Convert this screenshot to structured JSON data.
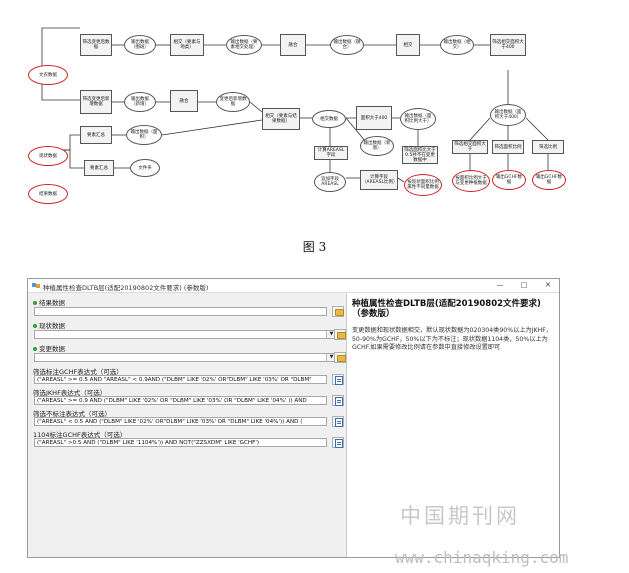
{
  "figure": {
    "caption": "图 3",
    "nodes": {
      "red1": "文农数据",
      "red2": "现状数据",
      "red3": "结果数据",
      "r1b1": "筛选变更后数据",
      "r1e1": "输出数据（图斑）",
      "r1b2": "相交（要素与地类）",
      "r1e2": "输出数据（要素相交处理）",
      "r1b3": "融合",
      "r1e3": "输出数据（融合）",
      "r1b4": "相交",
      "r1e4": "输出数据（相交）",
      "r1b5": "筛选相交面积大于400",
      "r2b1": "筛选变更后新增数据",
      "r2e1": "输出数据（新增）",
      "r2b2": "融合",
      "r2e2": "变更后新增数据",
      "mid1": "相交（要素与结果数据）",
      "mid2": "相交数据",
      "r3b1": "计算面积",
      "r3e1": "输出数据（新增）",
      "r3b2": "面积大于400",
      "r3e2": "输出数据（面积大于400）",
      "r3e3": "输出数据（面积）",
      "l1": "计算AREASL字段",
      "l2": "追加字段AREASL",
      "l3": "计算字段（AREASL比例）",
      "l4": "筛选面积比大于0.5并不在变更数据中",
      "red_s1": "按现状面积比例属性不同量数据",
      "right1": "输出数据（面积比例大于）",
      "ra": "筛选相交面积大于",
      "rb": "筛选面积比例",
      "rc": "筛选比例",
      "rd": "筛选比例",
      "red_r1": "按面积比例大于与变更种植数据",
      "red_r2": "输出GCHF数据",
      "red_r3": "输出GCHF数据",
      "sum1": "要素汇总",
      "sum2": "要素汇总",
      "sum3": "文件夹"
    }
  },
  "window": {
    "title": "种植属性检查DLTB层(适配20190802文件要求) (参数版)",
    "minimize": "—",
    "maximize": "□",
    "close": "✕",
    "params": {
      "p1_label": "结果数据",
      "p1_value": "",
      "p2_label": "现状数据",
      "p2_value": "",
      "p3_label": "变更数据",
      "p3_value": "",
      "p4_label": "筛选标注GCHF表达式（可选）",
      "p4_value": "(\"AREASL\" >= 0.5 AND \"AREASL\" < 0.9AND (\"DLBM\" LIKE '02%' OR\"DLBM\" LIKE '03%' OR \"DLBM\"",
      "p5_label": "筛选JKHF表达式（可选）",
      "p5_value": "(\"AREASL\" >= 0.9 AND (\"DLBM\" LIKE '02%' OR \"DLBM\" LIKE '03%' OR \"DLBM\" LIKE '04%' )) AND",
      "p6_label": "筛选不标注表达式（可选）",
      "p6_value": "(\"AREASL\" < 0.5  AND (\"DLBM\" LIKE '02%' OR\"DLBM\" LIKE '03%' OR \"DLBM\" LIKE '04%')) AND (",
      "p7_label": "1104标注GCHF表达式（可选）",
      "p7_value": "(\"AREASL\" >0.5 AND (\"DLBM\" LIKE '1104%')) AND NOT(\"ZZSXDM\" LIKE 'GCHF')"
    },
    "help": {
      "title": "种植属性检查DLTB层(适配20190802文件要求)（参数版）",
      "body": "变更数据和现状数据相交，默认现状数据为020304类90%以上为JKHF，50-90%为GCHF，50%以下为不标注；现状数据1104类，50%以上为GCHF.如果需要修改比例请在参数中直接修改设置即可"
    }
  },
  "watermark": {
    "line1": "中国期刊网",
    "line2": "www.chinaqking.com"
  }
}
